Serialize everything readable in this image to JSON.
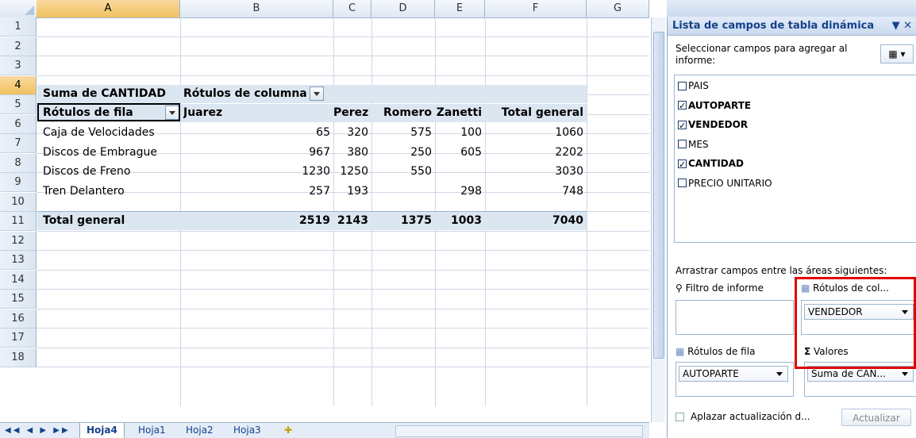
{
  "sheet": {
    "columns": [
      "A",
      "B",
      "C",
      "D",
      "E",
      "F",
      "G"
    ],
    "rows": [
      "1",
      "2",
      "3",
      "4",
      "5",
      "6",
      "7",
      "8",
      "9",
      "10",
      "11",
      "12",
      "13",
      "14",
      "15",
      "16",
      "17",
      "18"
    ],
    "pivot": {
      "value_label": "Suma de CANTIDAD",
      "col_labels": "Rótulos de columna",
      "row_labels": "Rótulos de fila",
      "col_headers": [
        "Juarez",
        "Perez",
        "Romero",
        "Zanetti",
        "Total general"
      ],
      "data": [
        {
          "label": "Caja de Velocidades",
          "values": [
            "65",
            "320",
            "575",
            "100",
            "1060"
          ]
        },
        {
          "label": "Discos de Embrague",
          "values": [
            "967",
            "380",
            "250",
            "605",
            "2202"
          ]
        },
        {
          "label": "Discos de Freno",
          "values": [
            "1230",
            "1250",
            "550",
            "",
            "3030"
          ]
        },
        {
          "label": "Tren Delantero",
          "values": [
            "257",
            "193",
            "",
            "298",
            "748"
          ]
        }
      ],
      "total": {
        "label": "Total general",
        "values": [
          "2519",
          "2143",
          "1375",
          "1003",
          "7040"
        ]
      }
    },
    "tabs": [
      "Hoja4",
      "Hoja1",
      "Hoja2",
      "Hoja3"
    ]
  },
  "panel": {
    "title": "Lista de campos de tabla dinámica",
    "instruction": "Seleccionar campos para agregar al informe:",
    "fields": [
      {
        "name": "PAIS",
        "checked": false
      },
      {
        "name": "AUTOPARTE",
        "checked": true
      },
      {
        "name": "VENDEDOR",
        "checked": true
      },
      {
        "name": "MES",
        "checked": false
      },
      {
        "name": "CANTIDAD",
        "checked": true
      },
      {
        "name": "PRECIO UNITARIO",
        "checked": false
      }
    ],
    "drag_text": "Arrastrar campos entre las áreas siguientes:",
    "filter_label": "Filtro de informe",
    "col_area_label": "Rótulos de col...",
    "col_area_value": "VENDEDOR",
    "row_area_label": "Rótulos de fila",
    "values_label": "Valores",
    "row_area_value": "AUTOPARTE",
    "values_value": "Suma de CAN...",
    "defer_label": "Aplazar actualización d...",
    "update_button": "Actualizar"
  },
  "colors": {
    "accent": "#15428b",
    "highlight": "#e00000",
    "pivot_band": "#dce6f1"
  }
}
